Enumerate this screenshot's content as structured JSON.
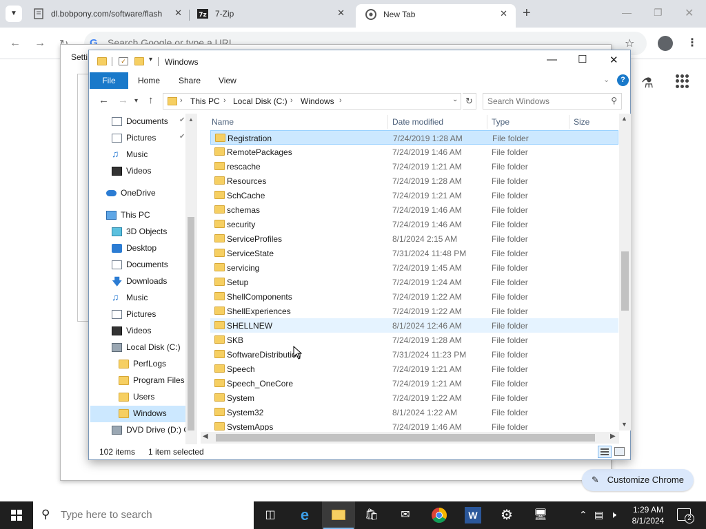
{
  "browser": {
    "tabs": [
      {
        "title": "dl.bobpony.com/software/flash",
        "icon": "page-icon"
      },
      {
        "title": "7-Zip",
        "icon": "7zip-icon"
      },
      {
        "title": "New Tab",
        "icon": "chrome-icon",
        "active": true
      }
    ],
    "omnibox_placeholder": "Search Google or type a URL",
    "settings_title": "Setti",
    "customize_label": "Customize Chrome"
  },
  "explorer": {
    "title": "Windows",
    "ribbon_tabs": [
      "File",
      "Home",
      "Share",
      "View"
    ],
    "address": [
      "This PC",
      "Local Disk (C:)",
      "Windows"
    ],
    "search_placeholder": "Search Windows",
    "nav": [
      {
        "label": "Documents",
        "icon": "documents-icon",
        "pinned": true
      },
      {
        "label": "Pictures",
        "icon": "pictures-icon",
        "pinned": true
      },
      {
        "label": "Music",
        "icon": "music-icon"
      },
      {
        "label": "Videos",
        "icon": "videos-icon"
      },
      {
        "label": "OneDrive",
        "icon": "onedrive-icon"
      },
      {
        "label": "This PC",
        "icon": "this-pc-icon"
      },
      {
        "label": "3D Objects",
        "icon": "3d-objects-icon"
      },
      {
        "label": "Desktop",
        "icon": "desktop-icon"
      },
      {
        "label": "Documents",
        "icon": "documents-icon"
      },
      {
        "label": "Downloads",
        "icon": "downloads-icon"
      },
      {
        "label": "Music",
        "icon": "music-icon"
      },
      {
        "label": "Pictures",
        "icon": "pictures-icon"
      },
      {
        "label": "Videos",
        "icon": "videos-icon"
      },
      {
        "label": "Local Disk (C:)",
        "icon": "local-disk-icon"
      },
      {
        "label": "PerfLogs",
        "icon": "folder-icon"
      },
      {
        "label": "Program Files",
        "icon": "folder-icon"
      },
      {
        "label": "Users",
        "icon": "folder-icon"
      },
      {
        "label": "Windows",
        "icon": "folder-icon",
        "selected": true
      },
      {
        "label": "DVD Drive (D:) C",
        "icon": "dvd-drive-icon"
      }
    ],
    "columns": [
      "Name",
      "Date modified",
      "Type",
      "Size"
    ],
    "files": [
      {
        "name": "Registration",
        "date": "7/24/2019 1:28 AM",
        "type": "File folder",
        "selected": true
      },
      {
        "name": "RemotePackages",
        "date": "7/24/2019 1:46 AM",
        "type": "File folder"
      },
      {
        "name": "rescache",
        "date": "7/24/2019 1:21 AM",
        "type": "File folder"
      },
      {
        "name": "Resources",
        "date": "7/24/2019 1:28 AM",
        "type": "File folder"
      },
      {
        "name": "SchCache",
        "date": "7/24/2019 1:21 AM",
        "type": "File folder"
      },
      {
        "name": "schemas",
        "date": "7/24/2019 1:46 AM",
        "type": "File folder"
      },
      {
        "name": "security",
        "date": "7/24/2019 1:46 AM",
        "type": "File folder"
      },
      {
        "name": "ServiceProfiles",
        "date": "8/1/2024 2:15 AM",
        "type": "File folder"
      },
      {
        "name": "ServiceState",
        "date": "7/31/2024 11:48 PM",
        "type": "File folder"
      },
      {
        "name": "servicing",
        "date": "7/24/2019 1:45 AM",
        "type": "File folder"
      },
      {
        "name": "Setup",
        "date": "7/24/2019 1:24 AM",
        "type": "File folder"
      },
      {
        "name": "ShellComponents",
        "date": "7/24/2019 1:22 AM",
        "type": "File folder"
      },
      {
        "name": "ShellExperiences",
        "date": "7/24/2019 1:22 AM",
        "type": "File folder"
      },
      {
        "name": "SHELLNEW",
        "date": "8/1/2024 12:46 AM",
        "type": "File folder",
        "hover": true
      },
      {
        "name": "SKB",
        "date": "7/24/2019 1:28 AM",
        "type": "File folder"
      },
      {
        "name": "SoftwareDistribution",
        "date": "7/31/2024 11:23 PM",
        "type": "File folder"
      },
      {
        "name": "Speech",
        "date": "7/24/2019 1:21 AM",
        "type": "File folder"
      },
      {
        "name": "Speech_OneCore",
        "date": "7/24/2019 1:21 AM",
        "type": "File folder"
      },
      {
        "name": "System",
        "date": "7/24/2019 1:22 AM",
        "type": "File folder"
      },
      {
        "name": "System32",
        "date": "8/1/2024 1:22 AM",
        "type": "File folder"
      },
      {
        "name": "SystemApps",
        "date": "7/24/2019 1:46 AM",
        "type": "File folder"
      }
    ],
    "status_count": "102 items",
    "status_selection": "1 item selected"
  },
  "taskbar": {
    "search_placeholder": "Type here to search",
    "time": "1:29 AM",
    "date": "8/1/2024",
    "notification_count": "2"
  },
  "colors": {
    "accent": "#1979ca",
    "selection": "#cce8ff",
    "folder": "#f6cf62",
    "taskbar": "#1f1f1f"
  }
}
